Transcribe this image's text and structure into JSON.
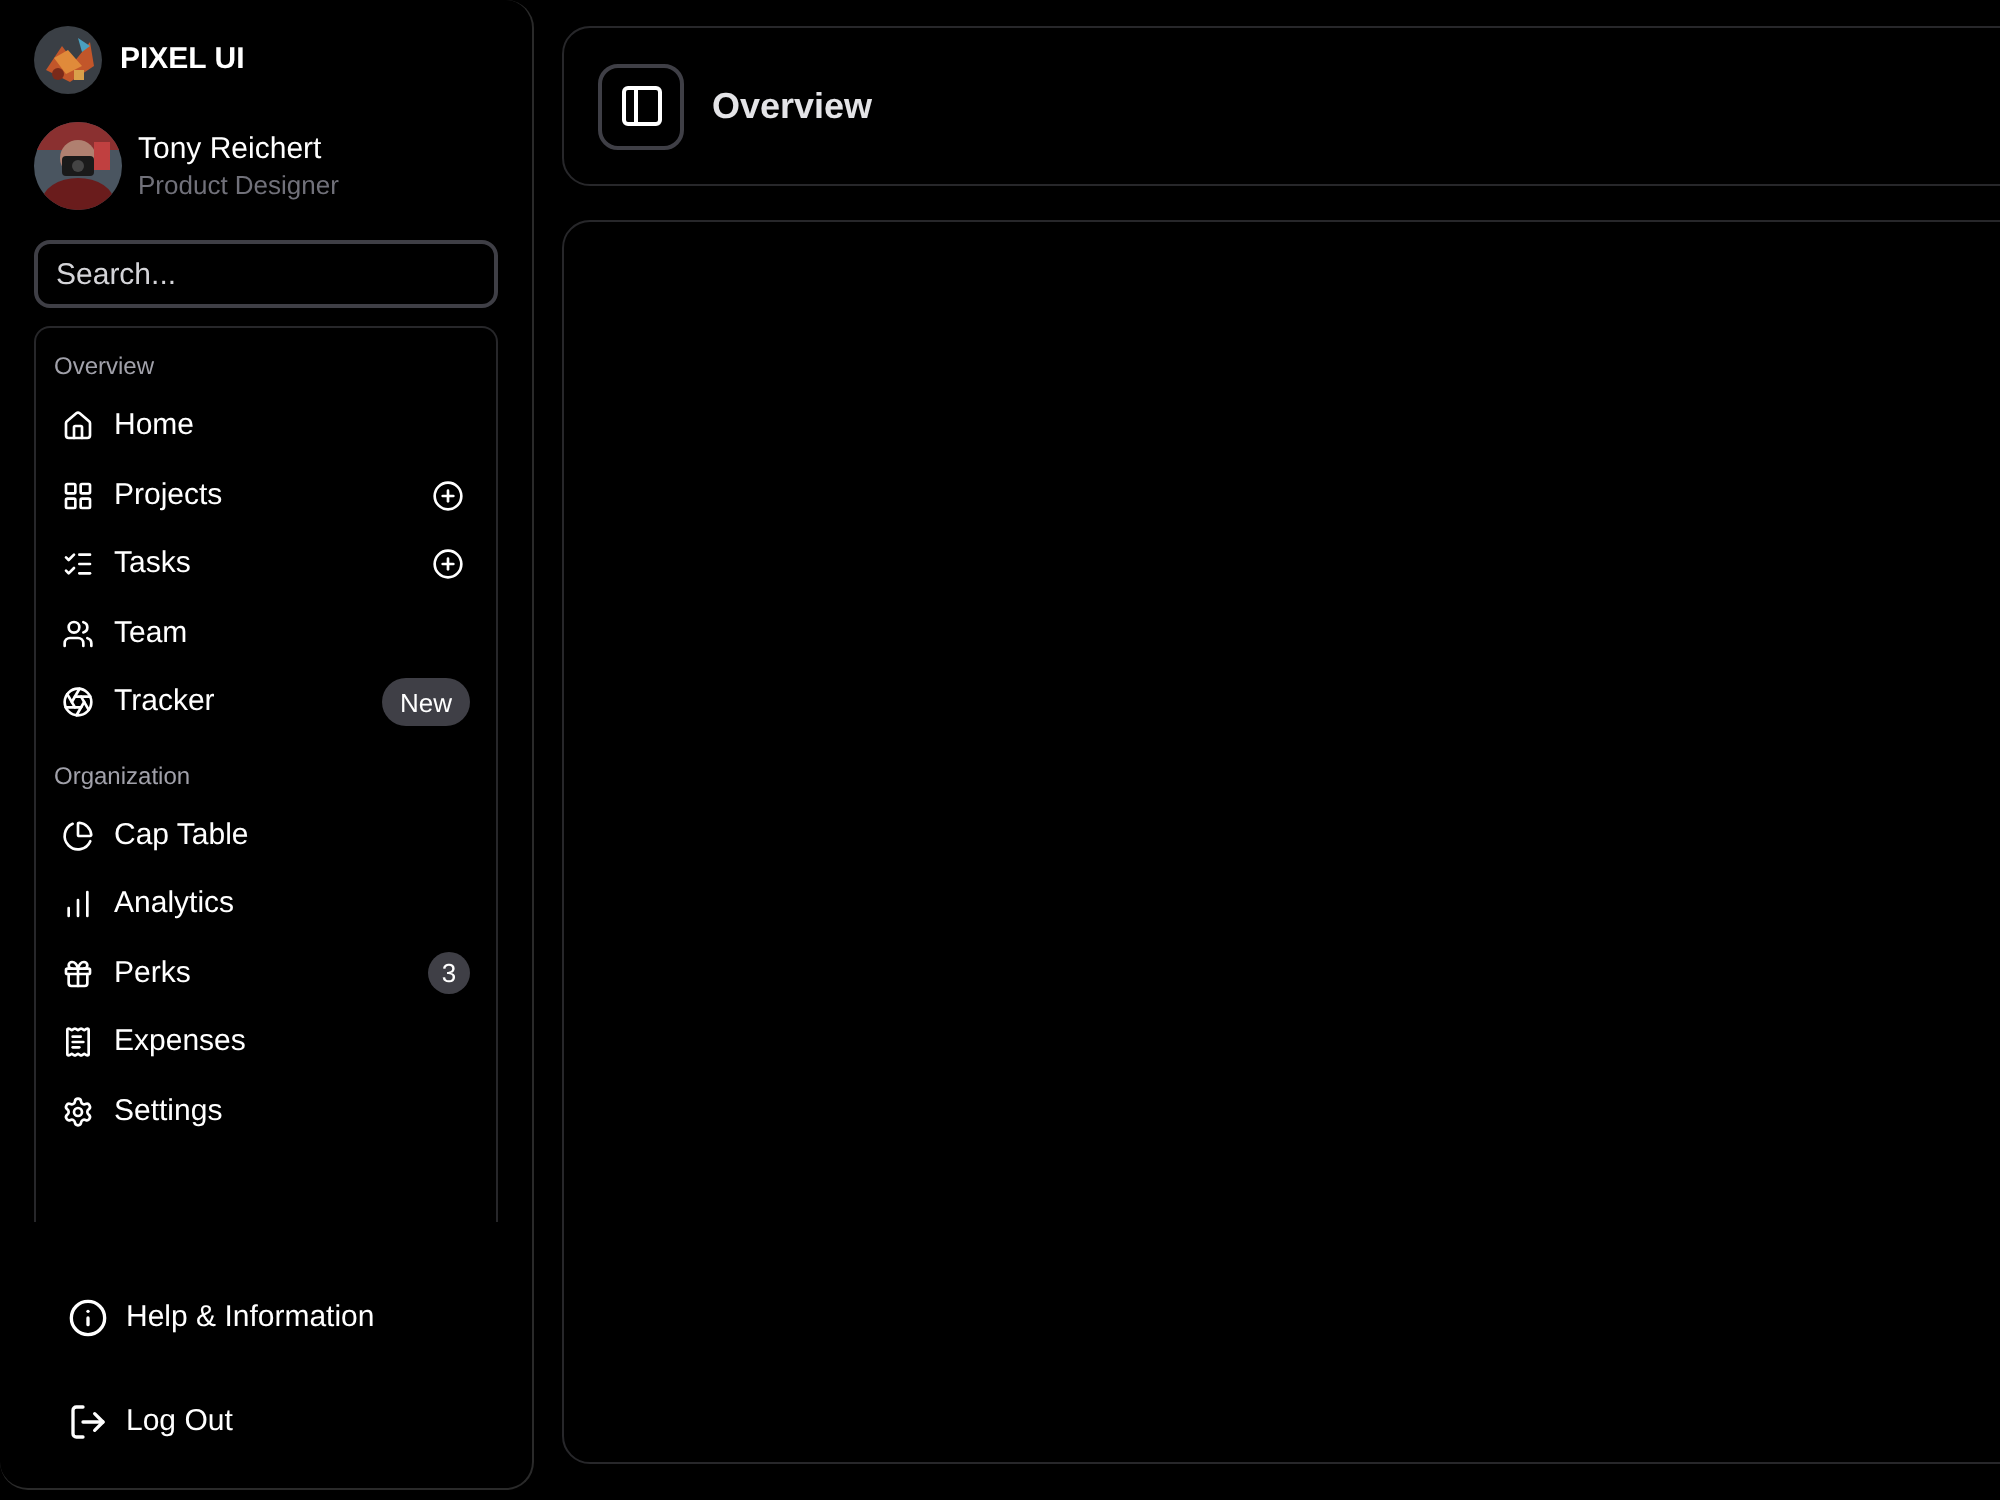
{
  "brand": {
    "name": "PIXEL UI"
  },
  "user": {
    "name": "Tony Reichert",
    "role": "Product Designer"
  },
  "search": {
    "placeholder": "Search..."
  },
  "sections": [
    {
      "title": "Overview",
      "items": [
        {
          "label": "Home",
          "kind": "plain"
        },
        {
          "label": "Projects",
          "kind": "add"
        },
        {
          "label": "Tasks",
          "kind": "add"
        },
        {
          "label": "Team",
          "kind": "plain"
        },
        {
          "label": "Tracker",
          "kind": "pill",
          "badge": "New"
        }
      ]
    },
    {
      "title": "Organization",
      "items": [
        {
          "label": "Cap Table",
          "kind": "plain"
        },
        {
          "label": "Analytics",
          "kind": "plain"
        },
        {
          "label": "Perks",
          "kind": "count",
          "badge": "3"
        },
        {
          "label": "Expenses",
          "kind": "plain"
        },
        {
          "label": "Settings",
          "kind": "plain"
        }
      ]
    }
  ],
  "footer": [
    {
      "label": "Help & Information"
    },
    {
      "label": "Log Out"
    }
  ],
  "header": {
    "title": "Overview"
  }
}
